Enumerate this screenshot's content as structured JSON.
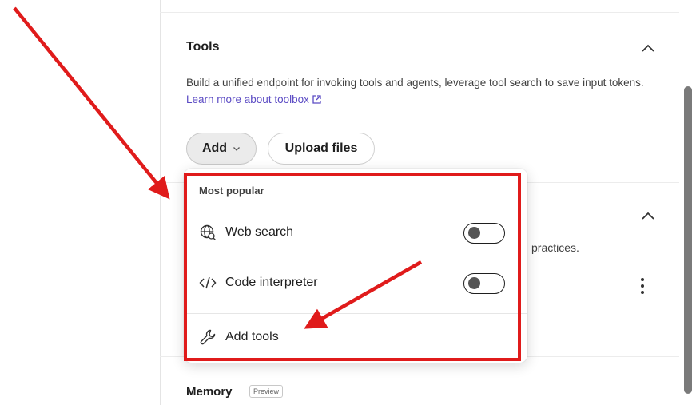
{
  "tools_section": {
    "title": "Tools",
    "description": "Build a unified endpoint for invoking tools and agents, leverage tool search to save input tokens.",
    "link_text": "Learn more about toolbox",
    "add_button": "Add",
    "upload_button": "Upload files"
  },
  "background": {
    "partial_text": "practices.",
    "next_section_title": "Memory",
    "next_section_badge": "Preview"
  },
  "dropdown": {
    "header": "Most popular",
    "items": [
      {
        "label": "Web search",
        "icon": "globe-icon",
        "toggle_on": false
      },
      {
        "label": "Code interpreter",
        "icon": "code-icon",
        "toggle_on": false
      }
    ],
    "add_tools_label": "Add tools",
    "add_tools_icon": "wrench-icon"
  },
  "annotation": {
    "color": "#e01b1b"
  },
  "colors": {
    "link": "#5b4bc4",
    "add_button_bg": "#ebebeb"
  }
}
